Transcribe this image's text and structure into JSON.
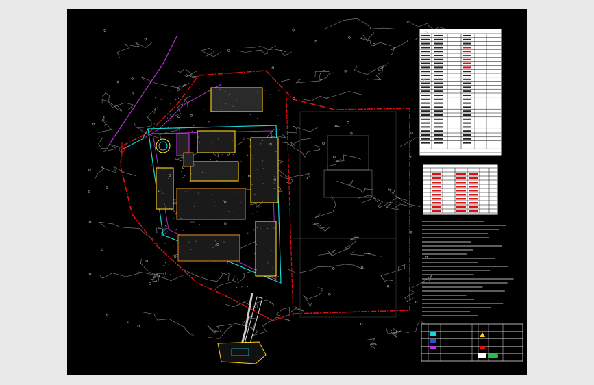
{
  "colors": {
    "background_outer": "#e8e8e8",
    "canvas": "#000000",
    "boundary_red": "#e01010",
    "building_yellow": "#ffd21a",
    "road_cyan": "#18d6d6",
    "road_magenta": "#c030e0",
    "building_orange": "#d88020",
    "terrain_gray": "#8a8a8a",
    "table_white": "#ffffff"
  },
  "icons": [
    "compass-icon",
    "tree-icon",
    "legend-symbol-icon"
  ]
}
